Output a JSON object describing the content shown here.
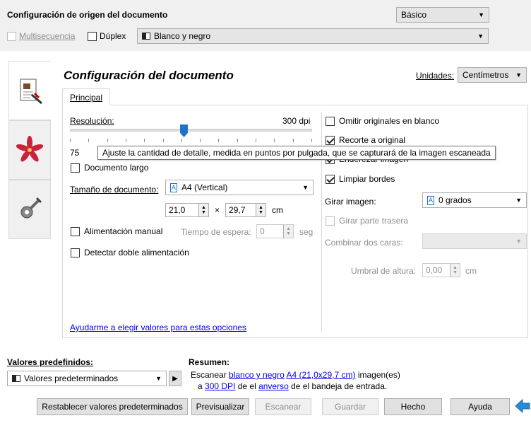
{
  "header": {
    "title": "Configuración de origen del documento",
    "mode_select": "Básico",
    "multisequence_label": "Multisecuencia",
    "duplex_label": "Dúplex",
    "color_mode": "Blanco y negro"
  },
  "doc_settings": {
    "title": "Configuración del documento",
    "units_label": "Unidades:",
    "units_value": "Centímetros",
    "tab_principal": "Principal"
  },
  "resolution": {
    "label": "Resolución:",
    "value_label": "300 dpi",
    "min_label": "75",
    "slider_fraction": 0.47,
    "tooltip": "Ajuste la cantidad de detalle, medida en puntos por pulgada, que se capturará de la imagen escaneada"
  },
  "left_options": {
    "long_doc": "Documento largo",
    "doc_size_label": "Tamaño de documento:",
    "doc_size_value": "A4 (Vertical)",
    "width": "21,0",
    "times": "×",
    "height": "29,7",
    "unit": "cm",
    "manual_feed": "Alimentación manual",
    "wait_time_label": "Tiempo de espera:",
    "wait_time_value": "0",
    "wait_unit": "seg",
    "double_feed": "Detectar doble alimentación",
    "help_link": "Ayudarme a elegir valores para estas opciones"
  },
  "right_options": {
    "skip_blank": "Omitir originales en blanco",
    "crop": "Recorte a original",
    "deskew": "Enderezar imagen",
    "clean_edges": "Limpiar bordes",
    "rotate_label": "Girar imagen:",
    "rotate_value": "0 grados",
    "rotate_back": "Girar parte trasera",
    "combine_label": "Combinar dos caras:",
    "threshold_label": "Umbral de altura:",
    "threshold_value": "0,00",
    "threshold_unit": "cm"
  },
  "presets": {
    "label": "Valores predefinidos:",
    "value": "Valores predeterminados"
  },
  "summary": {
    "label": "Resumen:",
    "line1_pre": "Escanear ",
    "line1_link1": "blanco y negro",
    "line1_space": " ",
    "line1_link2": "A4 (21,0x29,7 cm)",
    "line1_post": " imagen(es)",
    "line2_pre": "a ",
    "line2_link1": "300 DPI",
    "line2_mid": " de el ",
    "line2_link2": "anverso",
    "line2_post": " de el bandeja de entrada."
  },
  "buttons": {
    "reset": "Restablecer valores predeterminados",
    "preview": "Previsualizar",
    "scan": "Escanear",
    "save": "Guardar",
    "done": "Hecho",
    "help": "Ayuda"
  },
  "colors": {
    "accent_blue": "#1e73c8",
    "link": "#0000ee"
  }
}
